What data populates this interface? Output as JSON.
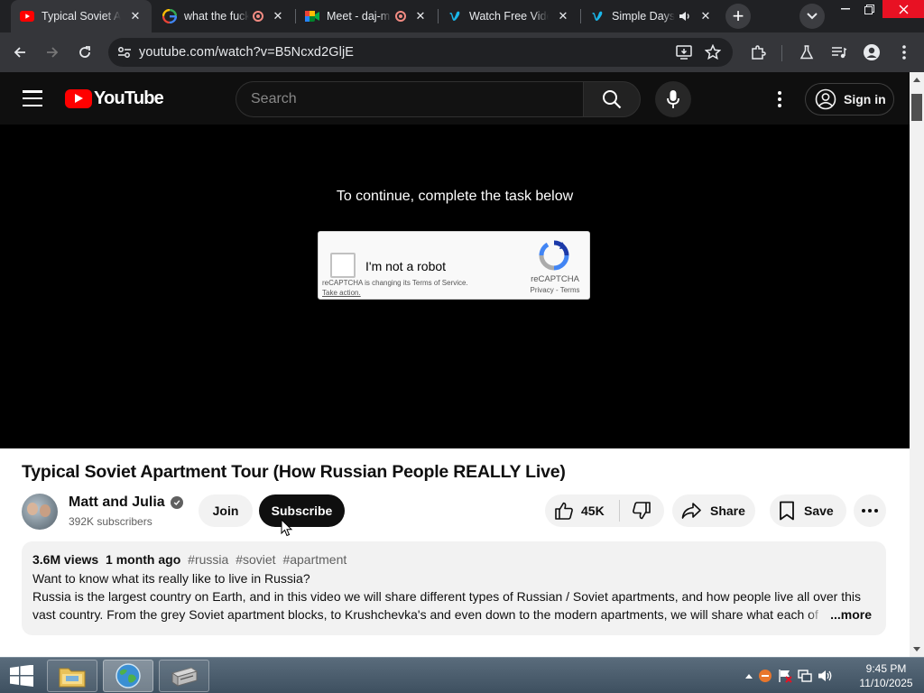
{
  "browser": {
    "tabs": [
      {
        "title": "Typical Soviet Apartment Tour",
        "favicon": "youtube-icon",
        "active": true
      },
      {
        "title": "what the fuck",
        "favicon": "google-icon",
        "recording": true
      },
      {
        "title": "Meet - daj-m",
        "favicon": "google-meet-icon",
        "recording": true
      },
      {
        "title": "Watch Free Videos",
        "favicon": "vimeo-icon"
      },
      {
        "title": "Simple Days",
        "favicon": "vimeo-icon",
        "audio": true
      }
    ],
    "url": "youtube.com/watch?v=B5Ncxd2GljE"
  },
  "youtube": {
    "search_placeholder": "Search",
    "sign_in_label": "Sign in",
    "player": {
      "prompt": "To continue, complete the task below",
      "captcha": {
        "label": "I'm not a robot",
        "notice": "reCAPTCHA is changing its Terms of Service.",
        "notice_link": "Take action.",
        "brand": "reCAPTCHA",
        "terms": "Privacy - Terms"
      }
    },
    "video": {
      "title": "Typical Soviet Apartment Tour (How Russian People REALLY Live)",
      "channel": "Matt and Julia",
      "subscribers": "392K subscribers",
      "join_label": "Join",
      "subscribe_label": "Subscribe",
      "likes": "45K",
      "share_label": "Share",
      "save_label": "Save"
    },
    "description": {
      "views": "3.6M views",
      "age": "1 month ago",
      "tags": [
        "#russia",
        "#soviet",
        "#apartment"
      ],
      "line1": "Want to know what its really like to live in Russia?",
      "line2": "Russia is the largest country on Earth, and in this video we will share different types of Russian / Soviet apartments, and how people live all over this",
      "line3": "vast country. From the grey Soviet apartment blocks, to Krushchevka's and even down to the modern apartments, we will share what each of th",
      "more_label": "...more"
    }
  },
  "taskbar": {
    "time": "9:45 PM",
    "date": "11/10/2025"
  },
  "colors": {
    "youtube_red": "#ff0000",
    "chrome_dark": "#202124",
    "youtube_dark": "#0f0f0f"
  }
}
